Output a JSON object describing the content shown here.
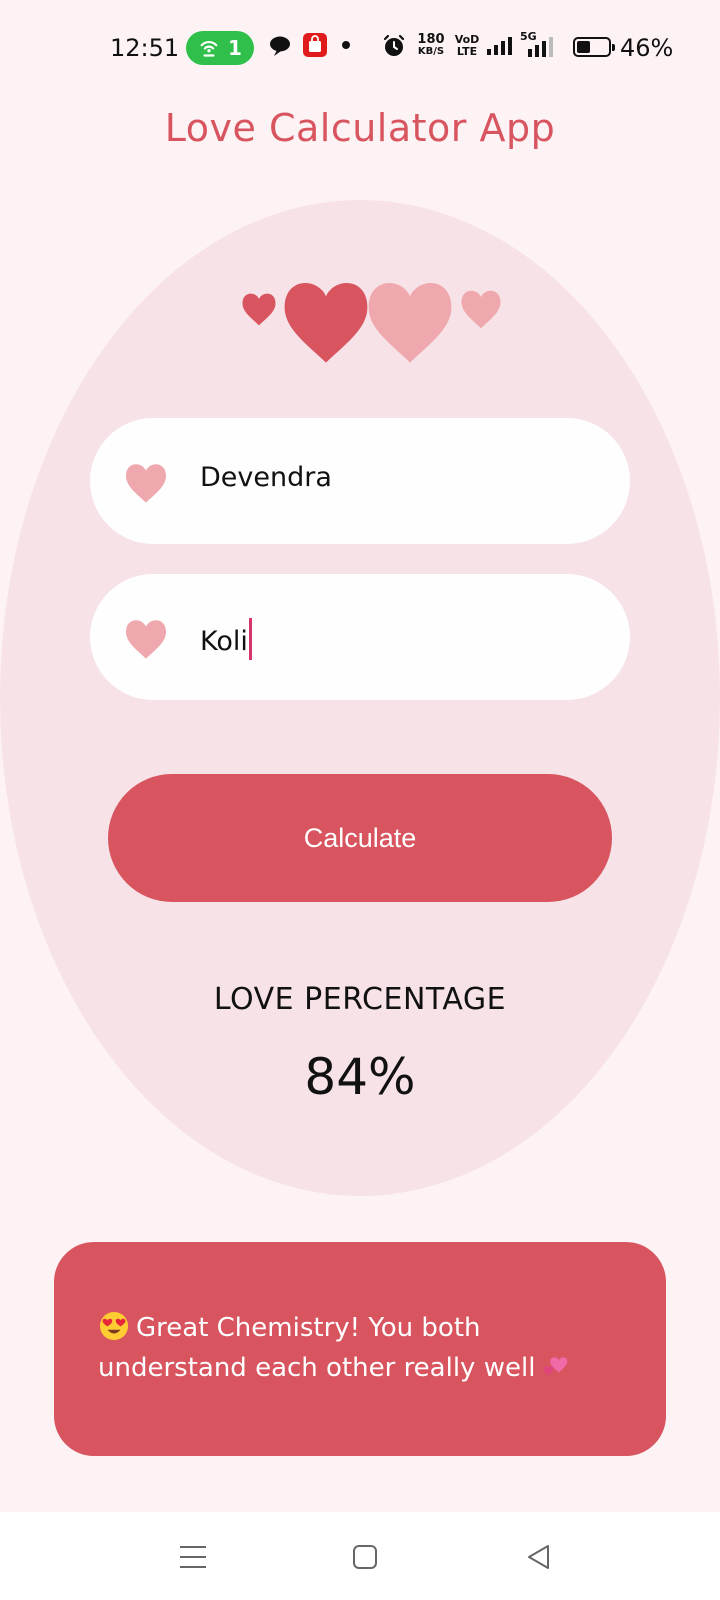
{
  "status_bar": {
    "time": "12:51",
    "hotspot_count": "1",
    "net_speed_value": "180",
    "net_speed_unit": "KB/S",
    "volte_top": "VoD",
    "volte_bottom": "LTE",
    "network_type": "5G",
    "battery_percent": "46%",
    "battery_level": 0.46
  },
  "app": {
    "title": "Love Calculator App"
  },
  "form": {
    "name1": "Devendra",
    "name2": "Koli",
    "calculate_label": "Calculate"
  },
  "result": {
    "label": "LOVE PERCENTAGE",
    "value": "84%",
    "message": "Great Chemistry! You both understand each other really well"
  },
  "colors": {
    "accent": "#d8545f",
    "background": "#fdf2f4",
    "oval": "#f7e3e7",
    "heart_dark": "#d8545f",
    "heart_light": "#efa9ae",
    "hotspot": "#2fbf4a"
  },
  "icons": {
    "decor_hearts": "heart-icon",
    "field_heart": "heart-icon",
    "message_emoji_start": "heart-eyes-emoji",
    "message_emoji_end": "two-hearts-emoji",
    "nav": [
      "menu-icon",
      "home-icon",
      "back-icon"
    ]
  }
}
